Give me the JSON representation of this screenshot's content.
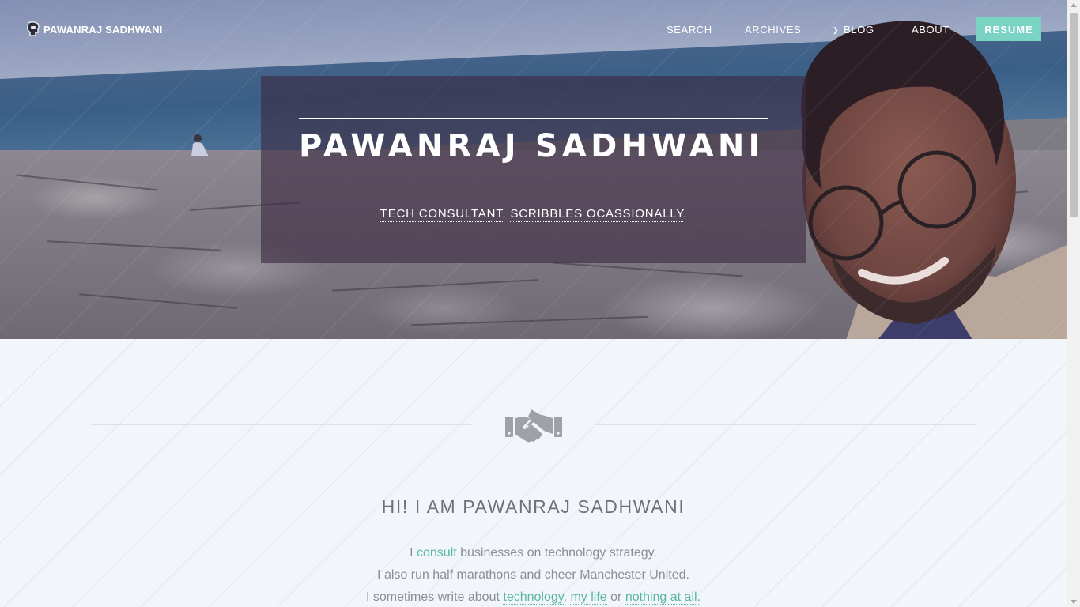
{
  "nav": {
    "brand": "PAWANRAJ SADHWANI",
    "items": [
      {
        "label": "SEARCH"
      },
      {
        "label": "ARCHIVES"
      },
      {
        "label": "BLOG",
        "icon": "chevron-down-icon"
      },
      {
        "label": "ABOUT"
      }
    ],
    "resume": "RESUME"
  },
  "hero": {
    "title": "PAWANRAJ SADHWANI",
    "tagline_1": "TECH CONSULTANT",
    "tagline_sep": ".",
    "tagline_2": "SCRIBBLES OCASSIONALLY",
    "tagline_end": "."
  },
  "main": {
    "icon": "handshake-icon",
    "greeting": "HI! I AM PAWANRAJ SADHWANI",
    "line1": {
      "pre": "I ",
      "link": "consult",
      "post": " businesses on technology strategy."
    },
    "line2": "I also run half marathons and cheer Manchester United.",
    "line3": {
      "pre": "I sometimes write about ",
      "link1": "technology",
      "sep1": ", ",
      "link2": "my life",
      "sep2": " or ",
      "link3": "nothing at all."
    }
  },
  "colors": {
    "accent": "#7bd4c3",
    "link": "#59b7a5",
    "overlay": "#3c2a40"
  }
}
